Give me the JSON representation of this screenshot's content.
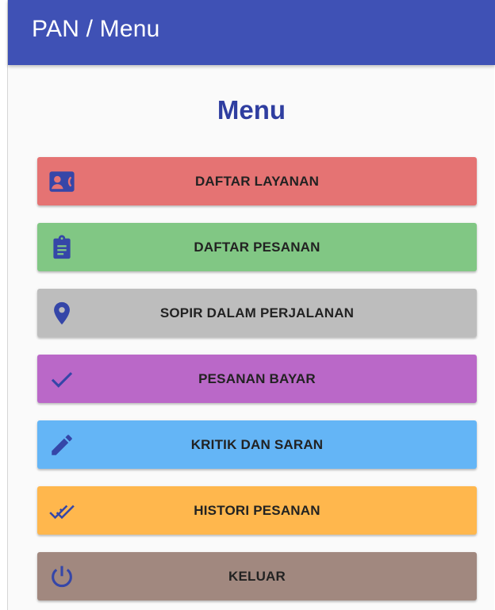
{
  "appbar": {
    "title": "PAN / Menu",
    "color": "#3f51b5"
  },
  "heading": "Menu",
  "icon_color": "#3546a8",
  "menu": [
    {
      "label": "DAFTAR LAYANAN",
      "icon": "contact-phone-icon",
      "color": "#e57373"
    },
    {
      "label": "DAFTAR PESANAN",
      "icon": "clipboard-icon",
      "color": "#81c784"
    },
    {
      "label": "SOPIR DALAM PERJALANAN",
      "icon": "location-pin-icon",
      "color": "#bdbdbd"
    },
    {
      "label": "PESANAN BAYAR",
      "icon": "check-icon",
      "color": "#ba68c8"
    },
    {
      "label": "KRITIK DAN SARAN",
      "icon": "pencil-icon",
      "color": "#64b5f6"
    },
    {
      "label": "HISTORI PESANAN",
      "icon": "double-check-icon",
      "color": "#ffb74d"
    },
    {
      "label": "KELUAR",
      "icon": "power-icon",
      "color": "#a1887f"
    }
  ]
}
